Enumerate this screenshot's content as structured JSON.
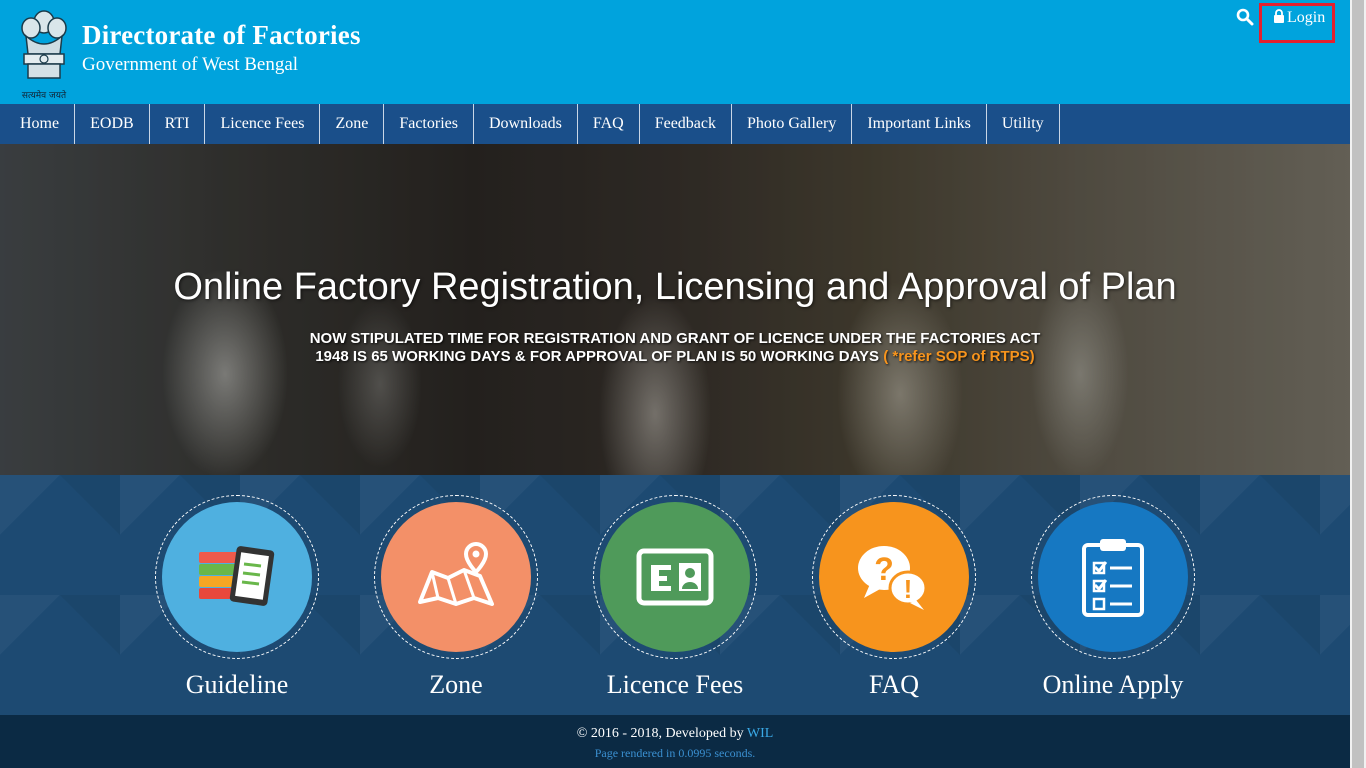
{
  "header": {
    "title": "Directorate of Factories",
    "subtitle": "Government of West Bengal",
    "emblem_motto": "सत्यमेव जयते",
    "login_label": "Login",
    "search_icon": "search-icon",
    "lock_icon": "lock-icon"
  },
  "nav": {
    "items": [
      "Home",
      "EODB",
      "RTI",
      "Licence Fees",
      "Zone",
      "Factories",
      "Downloads",
      "FAQ",
      "Feedback",
      "Photo Gallery",
      "Important Links",
      "Utility"
    ]
  },
  "hero": {
    "title": "Online Factory Registration, Licensing and Approval of Plan",
    "note_line1": "NOW STIPULATED TIME FOR REGISTRATION AND GRANT OF LICENCE UNDER THE FACTORIES ACT",
    "note_line2": "1948 IS 65 WORKING DAYS & FOR APPROVAL OF PLAN IS 50 WORKING DAYS",
    "note_ref": "( *refer SOP of RTPS)"
  },
  "features": [
    {
      "label": "Guideline",
      "icon": "books-tablet-icon",
      "color": "#4fb0e0"
    },
    {
      "label": "Zone",
      "icon": "map-pin-icon",
      "color": "#f39068"
    },
    {
      "label": "Licence Fees",
      "icon": "id-card-icon",
      "color": "#4f9a5a"
    },
    {
      "label": "FAQ",
      "icon": "question-exclamation-icon",
      "color": "#f7941d"
    },
    {
      "label": "Online Apply",
      "icon": "clipboard-checklist-icon",
      "color": "#1678c2"
    }
  ],
  "footer": {
    "copyright": "© 2016 - 2018, Developed by ",
    "developer": "WIL",
    "rendered": "Page rendered in 0.0995 seconds."
  },
  "colors": {
    "header_bg": "#00a3dd",
    "nav_bg": "#1a4f8a",
    "login_highlight": "#e4202f",
    "accent_orange": "#f7941d"
  }
}
